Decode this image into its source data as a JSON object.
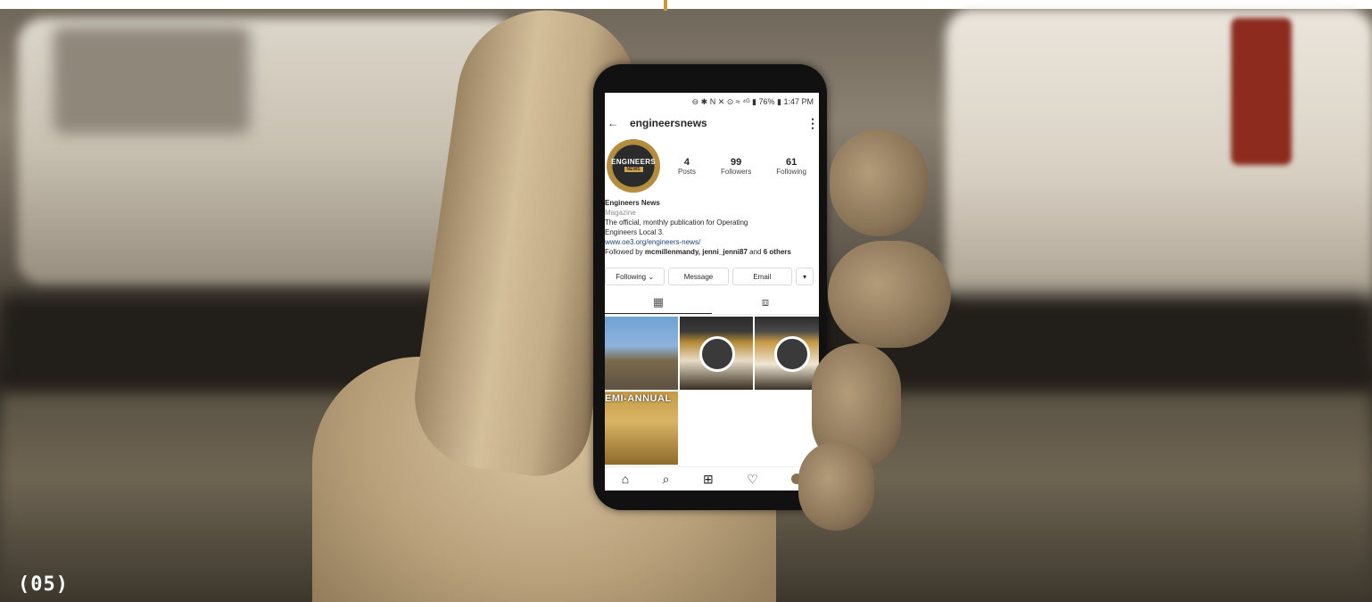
{
  "phone": {
    "status_bar": "⊖ ✱ N ✕ ⊙ ≈ ⁴ᴳ ▮ 76% ▮ 1:47 PM",
    "profile": {
      "username": "engineersnews",
      "avatar_logo": "ENGINEERS",
      "avatar_sub": "NEWS",
      "stats": [
        {
          "value": "4",
          "label": "Posts"
        },
        {
          "value": "99",
          "label": "Followers"
        },
        {
          "value": "61",
          "label": "Following"
        }
      ],
      "name": "Engineers News",
      "category": "Magazine",
      "bio_line1": "The official, monthly publication for Operating",
      "bio_line2": "Engineers Local 3.",
      "link": "www.oe3.org/engineers-news/",
      "followed_prefix": "Followed by ",
      "followed_names": "mcmillenmandy, jenni_jenni87",
      "followed_mid": " and ",
      "followed_others": "6 others"
    },
    "actions": {
      "following": "Following ⌄",
      "message": "Message",
      "email": "Email",
      "more": "▾"
    },
    "tabs": {
      "grid_icon": "▦",
      "tagged_icon": "⧈"
    },
    "grid": {
      "tile4_text": "EMI-ANNUAL"
    },
    "bottom_nav": {
      "home": "⌂",
      "search": "⌕",
      "add": "⊞",
      "heart": "♡"
    }
  },
  "label": "(05)"
}
